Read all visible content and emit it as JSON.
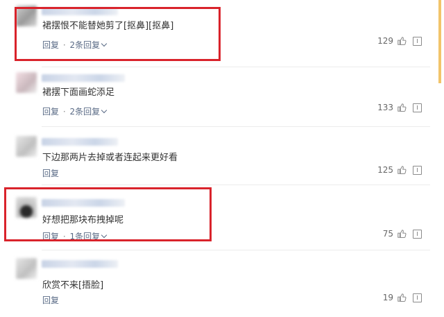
{
  "comments": [
    {
      "text": "裙摆恨不能替她剪了[抠鼻][抠鼻]",
      "reply": "回复",
      "replies": "2条回复",
      "likes": "129"
    },
    {
      "text": "裙摆下面画蛇添足",
      "reply": "回复",
      "replies": "2条回复",
      "likes": "133"
    },
    {
      "text": "下边那两片去掉或者连起来更好看",
      "reply": "回复",
      "replies": "",
      "likes": "125"
    },
    {
      "text": "好想把那块布拽掉呢",
      "reply": "回复",
      "replies": "1条回复",
      "likes": "75"
    },
    {
      "text": "欣赏不来[捂脸]",
      "reply": "回复",
      "replies": "",
      "likes": "19"
    }
  ],
  "separator": "·",
  "icons": {
    "like": "thumbs-up-icon",
    "report": "report-icon",
    "expand": "chevron-down-icon"
  },
  "colors": {
    "highlight": "#d9232b",
    "link": "#5a6b86",
    "accent": "#f2c46a"
  }
}
